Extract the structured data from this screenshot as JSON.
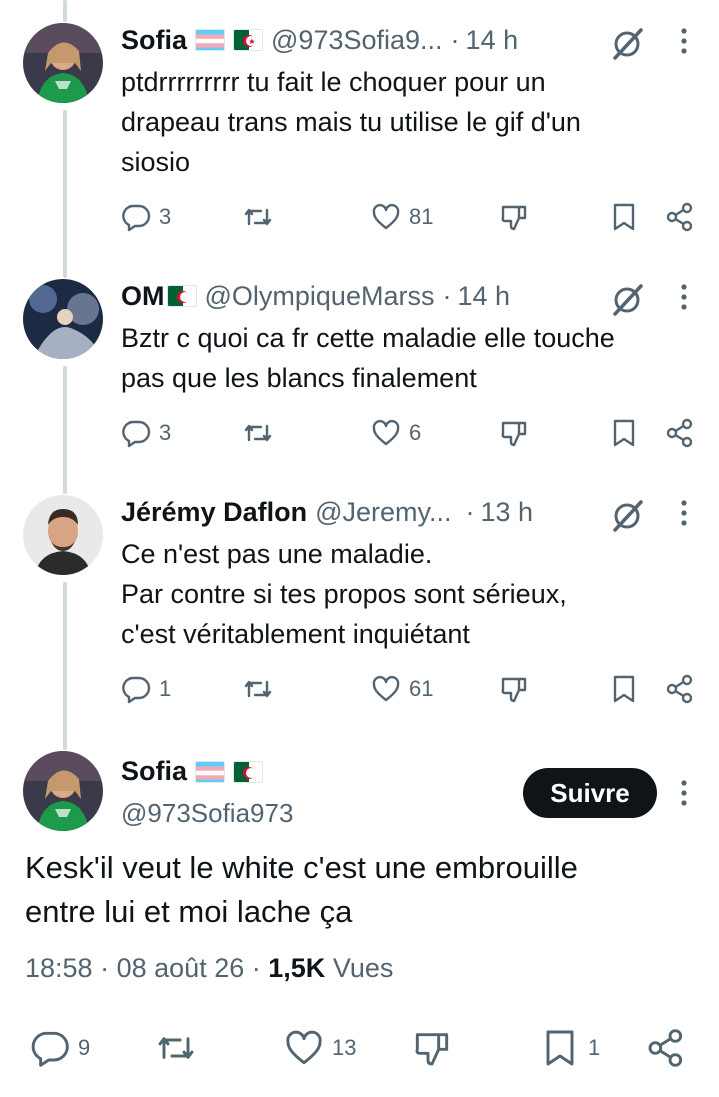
{
  "replies": [
    {
      "name": "Sofia",
      "handle": "@973Sofia9...",
      "time": "14 h",
      "lines": [
        "ptdrrrrrrrrr tu fait le choquer pour un",
        "drapeau trans mais tu utilise le gif d'un",
        "siosio"
      ],
      "replies": "3",
      "likes": "81"
    },
    {
      "name": "OM",
      "handle": "@OlympiqueMarss",
      "time": "14 h",
      "lines": [
        "Bztr c quoi ca fr cette maladie elle touche",
        "pas que les blancs finalement"
      ],
      "replies": "3",
      "likes": "6"
    },
    {
      "name": "Jérémy Daflon",
      "handle": "@Jeremy...",
      "time": "13 h",
      "lines": [
        "Ce n'est pas une maladie.",
        "Par contre si tes propos sont sérieux,",
        "c'est véritablement inquiétant"
      ],
      "replies": "1",
      "likes": "61"
    }
  ],
  "main": {
    "name": "Sofia",
    "handle": "@973Sofia973",
    "follow_label": "Suivre",
    "lines": [
      "Kesk'il veut le white c'est une embrouille",
      "entre lui et moi lache ça"
    ],
    "time": "18:58",
    "date": "08 août 26",
    "views_count": "1,5K",
    "views_label": "Vues",
    "replies": "9",
    "likes": "13",
    "bookmarks": "1"
  },
  "separator": "·",
  "icons": [
    "reply-icon",
    "retweet-icon",
    "like-icon",
    "dislike-icon",
    "bookmark-icon",
    "share-icon",
    "grok-icon",
    "more-icon"
  ],
  "colors": {
    "text": "#0f1419",
    "secondary": "#536471",
    "thread_line": "#cfd9de",
    "button": "#0f1419"
  }
}
